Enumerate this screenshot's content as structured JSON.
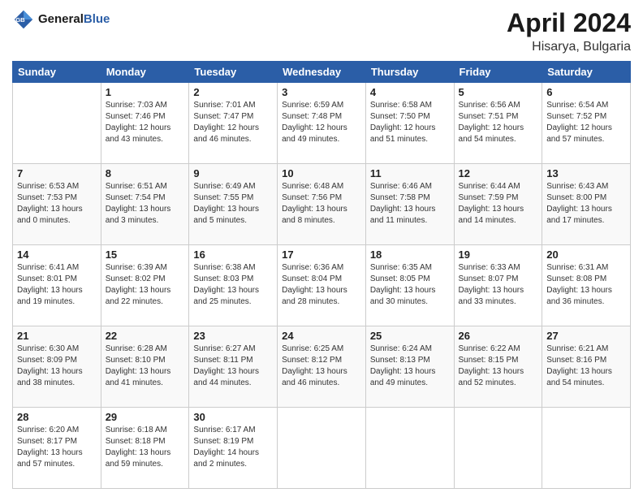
{
  "header": {
    "logo_general": "General",
    "logo_blue": "Blue",
    "title": "April 2024",
    "subtitle": "Hisarya, Bulgaria"
  },
  "weekdays": [
    "Sunday",
    "Monday",
    "Tuesday",
    "Wednesday",
    "Thursday",
    "Friday",
    "Saturday"
  ],
  "weeks": [
    [
      {
        "day": "",
        "info": ""
      },
      {
        "day": "1",
        "info": "Sunrise: 7:03 AM\nSunset: 7:46 PM\nDaylight: 12 hours\nand 43 minutes."
      },
      {
        "day": "2",
        "info": "Sunrise: 7:01 AM\nSunset: 7:47 PM\nDaylight: 12 hours\nand 46 minutes."
      },
      {
        "day": "3",
        "info": "Sunrise: 6:59 AM\nSunset: 7:48 PM\nDaylight: 12 hours\nand 49 minutes."
      },
      {
        "day": "4",
        "info": "Sunrise: 6:58 AM\nSunset: 7:50 PM\nDaylight: 12 hours\nand 51 minutes."
      },
      {
        "day": "5",
        "info": "Sunrise: 6:56 AM\nSunset: 7:51 PM\nDaylight: 12 hours\nand 54 minutes."
      },
      {
        "day": "6",
        "info": "Sunrise: 6:54 AM\nSunset: 7:52 PM\nDaylight: 12 hours\nand 57 minutes."
      }
    ],
    [
      {
        "day": "7",
        "info": "Sunrise: 6:53 AM\nSunset: 7:53 PM\nDaylight: 13 hours\nand 0 minutes."
      },
      {
        "day": "8",
        "info": "Sunrise: 6:51 AM\nSunset: 7:54 PM\nDaylight: 13 hours\nand 3 minutes."
      },
      {
        "day": "9",
        "info": "Sunrise: 6:49 AM\nSunset: 7:55 PM\nDaylight: 13 hours\nand 5 minutes."
      },
      {
        "day": "10",
        "info": "Sunrise: 6:48 AM\nSunset: 7:56 PM\nDaylight: 13 hours\nand 8 minutes."
      },
      {
        "day": "11",
        "info": "Sunrise: 6:46 AM\nSunset: 7:58 PM\nDaylight: 13 hours\nand 11 minutes."
      },
      {
        "day": "12",
        "info": "Sunrise: 6:44 AM\nSunset: 7:59 PM\nDaylight: 13 hours\nand 14 minutes."
      },
      {
        "day": "13",
        "info": "Sunrise: 6:43 AM\nSunset: 8:00 PM\nDaylight: 13 hours\nand 17 minutes."
      }
    ],
    [
      {
        "day": "14",
        "info": "Sunrise: 6:41 AM\nSunset: 8:01 PM\nDaylight: 13 hours\nand 19 minutes."
      },
      {
        "day": "15",
        "info": "Sunrise: 6:39 AM\nSunset: 8:02 PM\nDaylight: 13 hours\nand 22 minutes."
      },
      {
        "day": "16",
        "info": "Sunrise: 6:38 AM\nSunset: 8:03 PM\nDaylight: 13 hours\nand 25 minutes."
      },
      {
        "day": "17",
        "info": "Sunrise: 6:36 AM\nSunset: 8:04 PM\nDaylight: 13 hours\nand 28 minutes."
      },
      {
        "day": "18",
        "info": "Sunrise: 6:35 AM\nSunset: 8:05 PM\nDaylight: 13 hours\nand 30 minutes."
      },
      {
        "day": "19",
        "info": "Sunrise: 6:33 AM\nSunset: 8:07 PM\nDaylight: 13 hours\nand 33 minutes."
      },
      {
        "day": "20",
        "info": "Sunrise: 6:31 AM\nSunset: 8:08 PM\nDaylight: 13 hours\nand 36 minutes."
      }
    ],
    [
      {
        "day": "21",
        "info": "Sunrise: 6:30 AM\nSunset: 8:09 PM\nDaylight: 13 hours\nand 38 minutes."
      },
      {
        "day": "22",
        "info": "Sunrise: 6:28 AM\nSunset: 8:10 PM\nDaylight: 13 hours\nand 41 minutes."
      },
      {
        "day": "23",
        "info": "Sunrise: 6:27 AM\nSunset: 8:11 PM\nDaylight: 13 hours\nand 44 minutes."
      },
      {
        "day": "24",
        "info": "Sunrise: 6:25 AM\nSunset: 8:12 PM\nDaylight: 13 hours\nand 46 minutes."
      },
      {
        "day": "25",
        "info": "Sunrise: 6:24 AM\nSunset: 8:13 PM\nDaylight: 13 hours\nand 49 minutes."
      },
      {
        "day": "26",
        "info": "Sunrise: 6:22 AM\nSunset: 8:15 PM\nDaylight: 13 hours\nand 52 minutes."
      },
      {
        "day": "27",
        "info": "Sunrise: 6:21 AM\nSunset: 8:16 PM\nDaylight: 13 hours\nand 54 minutes."
      }
    ],
    [
      {
        "day": "28",
        "info": "Sunrise: 6:20 AM\nSunset: 8:17 PM\nDaylight: 13 hours\nand 57 minutes."
      },
      {
        "day": "29",
        "info": "Sunrise: 6:18 AM\nSunset: 8:18 PM\nDaylight: 13 hours\nand 59 minutes."
      },
      {
        "day": "30",
        "info": "Sunrise: 6:17 AM\nSunset: 8:19 PM\nDaylight: 14 hours\nand 2 minutes."
      },
      {
        "day": "",
        "info": ""
      },
      {
        "day": "",
        "info": ""
      },
      {
        "day": "",
        "info": ""
      },
      {
        "day": "",
        "info": ""
      }
    ]
  ]
}
